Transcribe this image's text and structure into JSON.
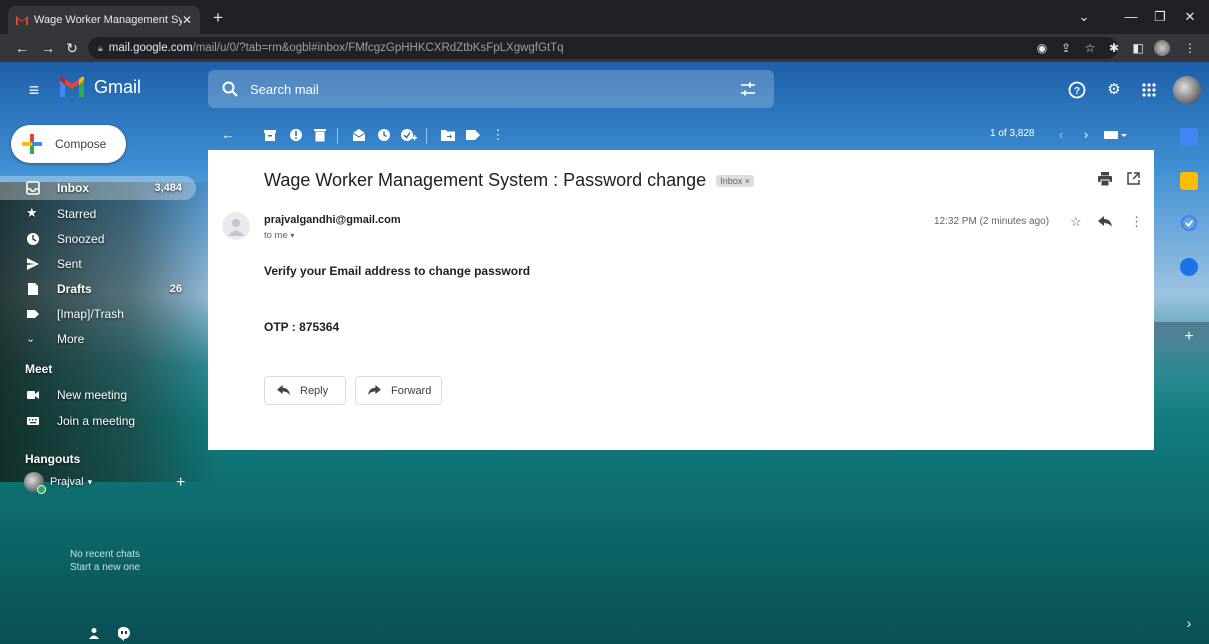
{
  "browser": {
    "tab_title": "Wage Worker Management Syste",
    "new_tab": "+",
    "url_host": "mail.google.com",
    "url_path": "/mail/u/0/?tab=rm&ogbl#inbox/FMfcgzGpHHKCXRdZtbKsFpLXgwgfGtTq"
  },
  "gmail": {
    "logo_text": "Gmail",
    "search_placeholder": "Search mail"
  },
  "sidebar": {
    "compose_label": "Compose",
    "items": [
      {
        "label": "Inbox",
        "count": "3,484"
      },
      {
        "label": "Starred",
        "count": ""
      },
      {
        "label": "Snoozed",
        "count": ""
      },
      {
        "label": "Sent",
        "count": ""
      },
      {
        "label": "Drafts",
        "count": "26"
      },
      {
        "label": "[Imap]/Trash",
        "count": ""
      },
      {
        "label": "More",
        "count": ""
      }
    ],
    "meet_label": "Meet",
    "meet_items": [
      "New meeting",
      "Join a meeting"
    ],
    "hangouts_label": "Hangouts",
    "hangout_user": "Prajval",
    "no_chats": "No recent chats",
    "start_new": "Start a new one"
  },
  "toolbar": {
    "pagination": "1 of 3,828"
  },
  "email": {
    "subject": "Wage Worker Management System : Password change",
    "label_chip": "Inbox ×",
    "sender": "prajvalgandhi@gmail.com",
    "to": "to me",
    "timestamp": "12:32 PM (2 minutes ago)",
    "body_line1": "Verify your Email address to change password",
    "otp_line": "OTP : 875364",
    "reply_label": "Reply",
    "forward_label": "Forward"
  },
  "colors": {
    "compose_plus_red": "#ea4335",
    "compose_plus_blue": "#4285f4",
    "compose_plus_green": "#34a853",
    "compose_plus_yellow": "#fbbc04"
  }
}
